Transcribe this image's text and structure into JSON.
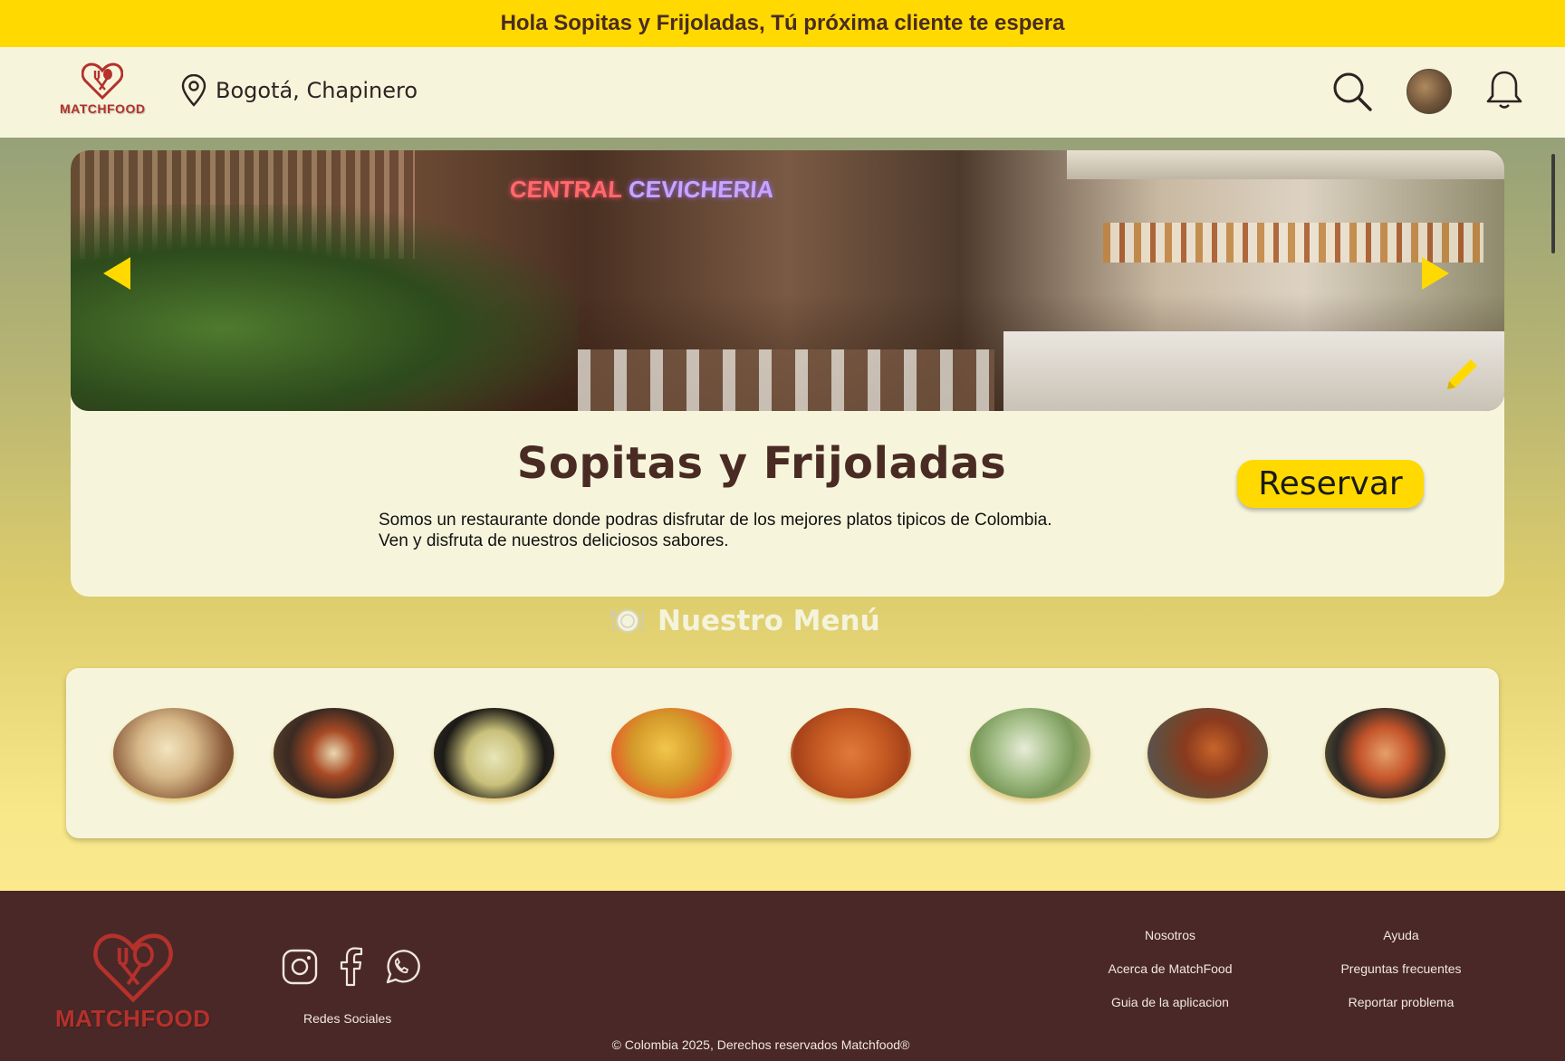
{
  "greeting_bar": {
    "text": "Hola Sopitas y Frijoladas, Tú próxima cliente te espera"
  },
  "header": {
    "logo_text": "MATCHFOOD",
    "location": "Bogotá, Chapinero",
    "icons": [
      "location-pin-icon",
      "search-icon",
      "avatar",
      "bell-icon"
    ]
  },
  "banner": {
    "sign_text_1": "CENTRAL",
    "sign_text_2": "CEVICHERIA",
    "controls": [
      "arrow-left-icon",
      "arrow-right-icon",
      "pencil-icon"
    ]
  },
  "restaurant": {
    "name": "Sopitas y Frijoladas",
    "description_line1": "Somos un restaurante donde podras disfrutar de los mejores platos tipicos de Colombia.",
    "description_line2": "Ven y disfruta de nuestros deliciosos sabores.",
    "reserve_label": "Reservar"
  },
  "menu": {
    "title": "Nuestro Menú",
    "icon": "plate-cutlery-icon",
    "dish_count_visible": 8
  },
  "footer": {
    "logo_text": "MATCHFOOD",
    "social_label": "Redes Sociales",
    "social_icons": [
      "instagram-icon",
      "facebook-icon",
      "whatsapp-icon"
    ],
    "col1": [
      "Nosotros",
      "Acerca de MatchFood",
      "Guia de la aplicacion"
    ],
    "col2": [
      "Ayuda",
      "Preguntas frecuentes",
      "Reportar problema"
    ],
    "copyright": "© Colombia 2025, Derechos reservados Matchfood®"
  },
  "colors": {
    "accent_yellow": "#ffd900",
    "brand_red": "#b5312b",
    "dark_brown": "#4a2828",
    "cream": "#f6f5dc"
  }
}
